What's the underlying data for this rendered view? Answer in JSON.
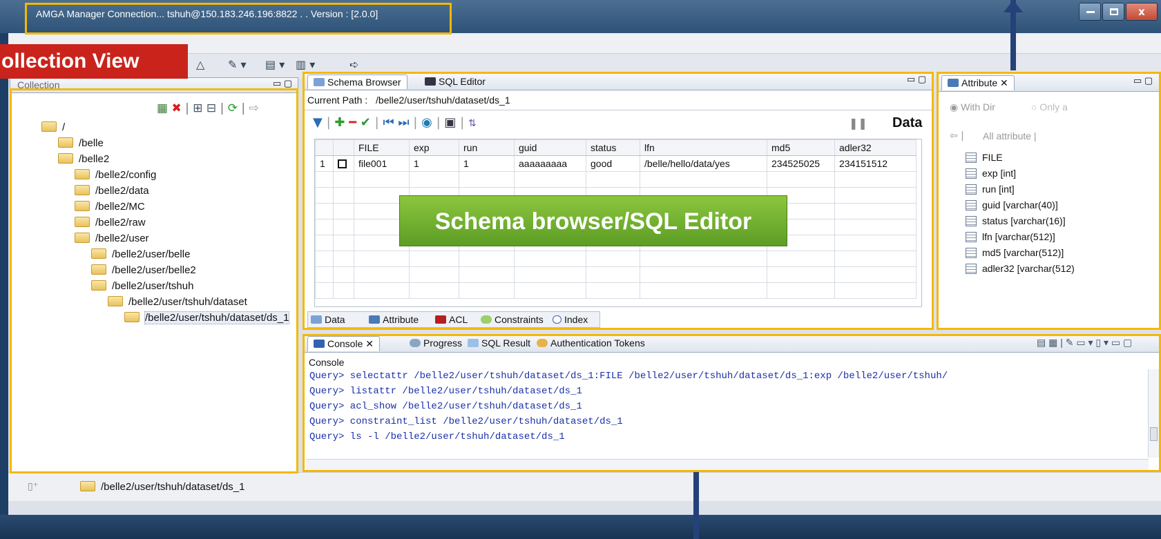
{
  "window": {
    "title": "AMGA Manager Connection... tshuh@150.183.246.196:8822 . . Version : [2.0.0]",
    "close_glyph": "x"
  },
  "annotations": {
    "collection_view": "ollection View",
    "schema_browser": "Schema browser/SQL Editor"
  },
  "collection": {
    "tab_label": "Collection",
    "tree": [
      {
        "label": "/"
      },
      {
        "label": "/belle"
      },
      {
        "label": "/belle2"
      },
      {
        "label": "/belle2/config"
      },
      {
        "label": "/belle2/data"
      },
      {
        "label": "/belle2/MC"
      },
      {
        "label": "/belle2/raw"
      },
      {
        "label": "/belle2/user"
      },
      {
        "label": "/belle2/user/belle"
      },
      {
        "label": "/belle2/user/belle2"
      },
      {
        "label": "/belle2/user/tshuh"
      },
      {
        "label": "/belle2/user/tshuh/dataset"
      },
      {
        "label": "/belle2/user/tshuh/dataset/ds_1"
      }
    ]
  },
  "editor": {
    "tabs": [
      "Schema Browser",
      "SQL Editor"
    ],
    "current_path_label": "Current Path :",
    "current_path": "/belle2/user/tshuh/dataset/ds_1",
    "data_label": "Data",
    "columns": [
      "FILE",
      "exp",
      "run",
      "guid",
      "status",
      "lfn",
      "md5",
      "adler32"
    ],
    "rows": [
      {
        "num": "1",
        "values": [
          "file001",
          "1",
          "1",
          "aaaaaaaaa",
          "good",
          "/belle/hello/data/yes",
          "234525025",
          "234151512"
        ]
      }
    ],
    "bottom_tabs": [
      "Data",
      "Attribute",
      "ACL",
      "Constraints",
      "Index"
    ]
  },
  "attribute": {
    "tab_label": "Attribute",
    "radio_with_dir": "With Dir",
    "radio_only": "Only a",
    "all_attribute": "All attribute",
    "items": [
      "FILE",
      "exp [int]",
      "run [int]",
      "guid [varchar(40)]",
      "status [varchar(16)]",
      "lfn [varchar(512)]",
      "md5 [varchar(512)]",
      "adler32 [varchar(512)"
    ]
  },
  "console": {
    "tabs": [
      "Console",
      "Progress",
      "SQL Result",
      "Authentication Tokens"
    ],
    "header": "Console",
    "lines": [
      "Query> selectattr /belle2/user/tshuh/dataset/ds_1:FILE /belle2/user/tshuh/dataset/ds_1:exp /belle2/user/tshuh/",
      "Query> listattr /belle2/user/tshuh/dataset/ds_1",
      "Query> acl_show /belle2/user/tshuh/dataset/ds_1",
      "Query> constraint_list /belle2/user/tshuh/dataset/ds_1",
      "Query> ls -l /belle2/user/tshuh/dataset/ds_1"
    ]
  },
  "status": {
    "path": "/belle2/user/tshuh/dataset/ds_1"
  },
  "colors": {
    "highlight": "#f5b800",
    "red_label": "#c9231c",
    "green_label": "#6aaa2c",
    "console_text": "#1a2fa8"
  }
}
